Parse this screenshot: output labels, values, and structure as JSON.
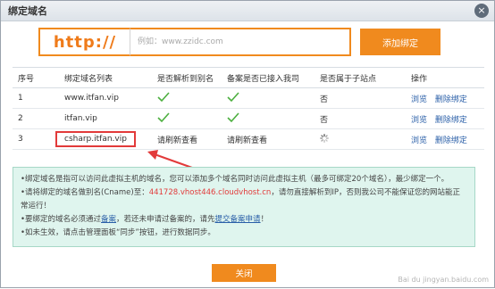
{
  "dialog": {
    "title": "绑定域名",
    "close_glyph": "×"
  },
  "add_row": {
    "prefix": "http://",
    "placeholder": "例如：www.zzidc.com",
    "add_button": "添加绑定"
  },
  "table": {
    "headers": [
      "序号",
      "绑定域名列表",
      "是否解析到别名",
      "备案是否已接入我司",
      "是否属于子站点",
      "操作"
    ],
    "rows": [
      {
        "no": "1",
        "domain": "www.itfan.vip",
        "alias": "",
        "icp": "",
        "sub": "否",
        "browse": "浏览",
        "delete": "删除绑定"
      },
      {
        "no": "2",
        "domain": "itfan.vip",
        "alias": "",
        "icp": "",
        "sub": "否",
        "browse": "浏览",
        "delete": "删除绑定"
      },
      {
        "no": "3",
        "domain": "csharp.itfan.vip",
        "alias": "请刷新查看",
        "icp": "请刷新查看",
        "sub": "",
        "browse": "浏览",
        "delete": "删除绑定"
      }
    ]
  },
  "notice": {
    "line1": "•绑定域名是指可以访问此虚拟主机的域名，您可以添加多个域名同时访问此虚拟主机（最多可绑定20个域名），最少绑定一个。",
    "line2a": "•请将绑定的域名做别名(Cname)至：",
    "cname": "441728.vhost446.cloudvhost.cn",
    "line2b": "，请勿直接解析到IP，否则我公司不能保证您的网站能正常运行！",
    "line3a": "•要绑定的域名必须通过",
    "beian_link": "备案",
    "line3b": "，若还未申请过备案的，请先",
    "apply_link": "提交备案申请",
    "line3c": "！",
    "line4": "•如未生效，请点击管理面板“同步”按钮，进行数据同步。"
  },
  "footer": {
    "close_button": "关闭"
  },
  "watermark": "Bai du jingyan.baidu.com",
  "colors": {
    "accent": "#f08a1e",
    "link": "#2a5fa8",
    "check": "#4caf3f",
    "highlight": "#e23a3a",
    "notice_bg": "#dff5ee"
  }
}
